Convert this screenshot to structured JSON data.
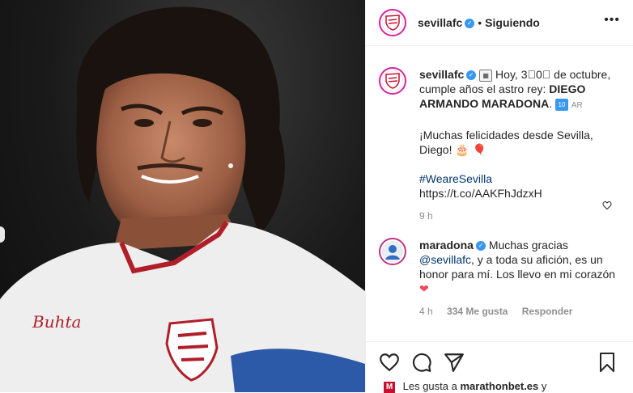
{
  "post": {
    "account": "sevillafc",
    "follow_status": "Siguiendo",
    "more": "•••"
  },
  "caption": {
    "username": "sevillafc",
    "text_1": "Hoy,",
    "day_tiles": "3⃣0⃣",
    "text_2": "de octubre, cumple años el astro rey:",
    "name_bold": "DIEGO ARMANDO MARADONA",
    "text_3": ".",
    "number": "10",
    "flag": "AR",
    "line2": "¡Muchas felicidades desde Sevilla, Diego!",
    "hashtag": "#WeareSevilla",
    "url": "https://t.co/AAKFhJdzxH",
    "time": "9 h"
  },
  "reply": {
    "username": "maradona",
    "text_a": "Muchas gracias",
    "mention": "@sevillafc",
    "text_b": ", y a toda su afición, es un honor para mí. Los llevo en mi corazón",
    "time": "4 h",
    "likes": "334 Me gusta",
    "reply_label": "Responder"
  },
  "likes_line": {
    "prefix": "Les gusta a",
    "user": "marathonbet.es",
    "suffix": "y"
  },
  "icons": {
    "like": "heart-icon",
    "comment": "comment-icon",
    "share": "share-icon",
    "save": "bookmark-icon"
  },
  "colors": {
    "link": "#00376b",
    "verified": "#3897f0",
    "story_ring": "#d6249f",
    "heart": "#ed4956"
  }
}
